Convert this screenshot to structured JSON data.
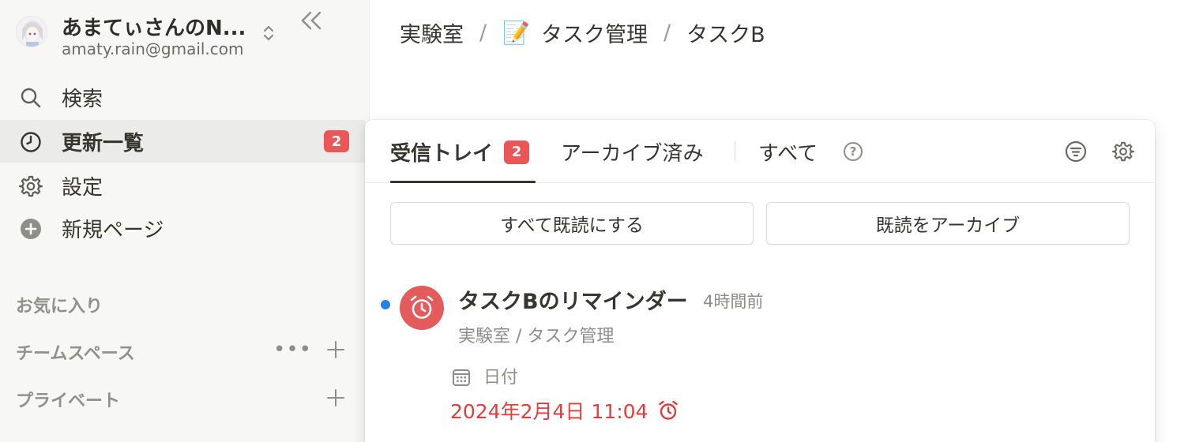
{
  "workspace": {
    "name": "あまてぃさんのN...",
    "email": "amaty.rain@gmail.com"
  },
  "sidebar": {
    "items": [
      {
        "label": "検索",
        "icon": "search-icon"
      },
      {
        "label": "更新一覧",
        "icon": "clock-icon",
        "badge": "2",
        "active": true
      },
      {
        "label": "設定",
        "icon": "gear-icon"
      },
      {
        "label": "新規ページ",
        "icon": "plus-circle-icon"
      }
    ],
    "sections": {
      "favorites": "お気に入り",
      "teamspace": "チームスペース",
      "private": "プライベート"
    }
  },
  "breadcrumb": {
    "items": [
      "実験室",
      "タスク管理",
      "タスクB"
    ],
    "page_emoji": "📝",
    "separator": "/"
  },
  "inbox": {
    "tabs": [
      {
        "label": "受信トレイ",
        "badge": "2",
        "active": true
      },
      {
        "label": "アーカイブ済み"
      },
      {
        "label": "すべて"
      }
    ],
    "help_icon": "?",
    "buttons": {
      "mark_all_read": "すべて既読にする",
      "archive_read": "既読をアーカイブ"
    },
    "notification": {
      "title": "タスクBのリマインダー",
      "time": "4時間前",
      "path": "実験室 / タスク管理",
      "property_label": "日付",
      "property_value": "2024年2月4日 11:04",
      "unread": true
    }
  },
  "colors": {
    "badge": "#eb5757",
    "accent_red": "#e03e3e",
    "unread_blue": "#2383e2",
    "sidebar_bg": "#f7f7f5"
  }
}
